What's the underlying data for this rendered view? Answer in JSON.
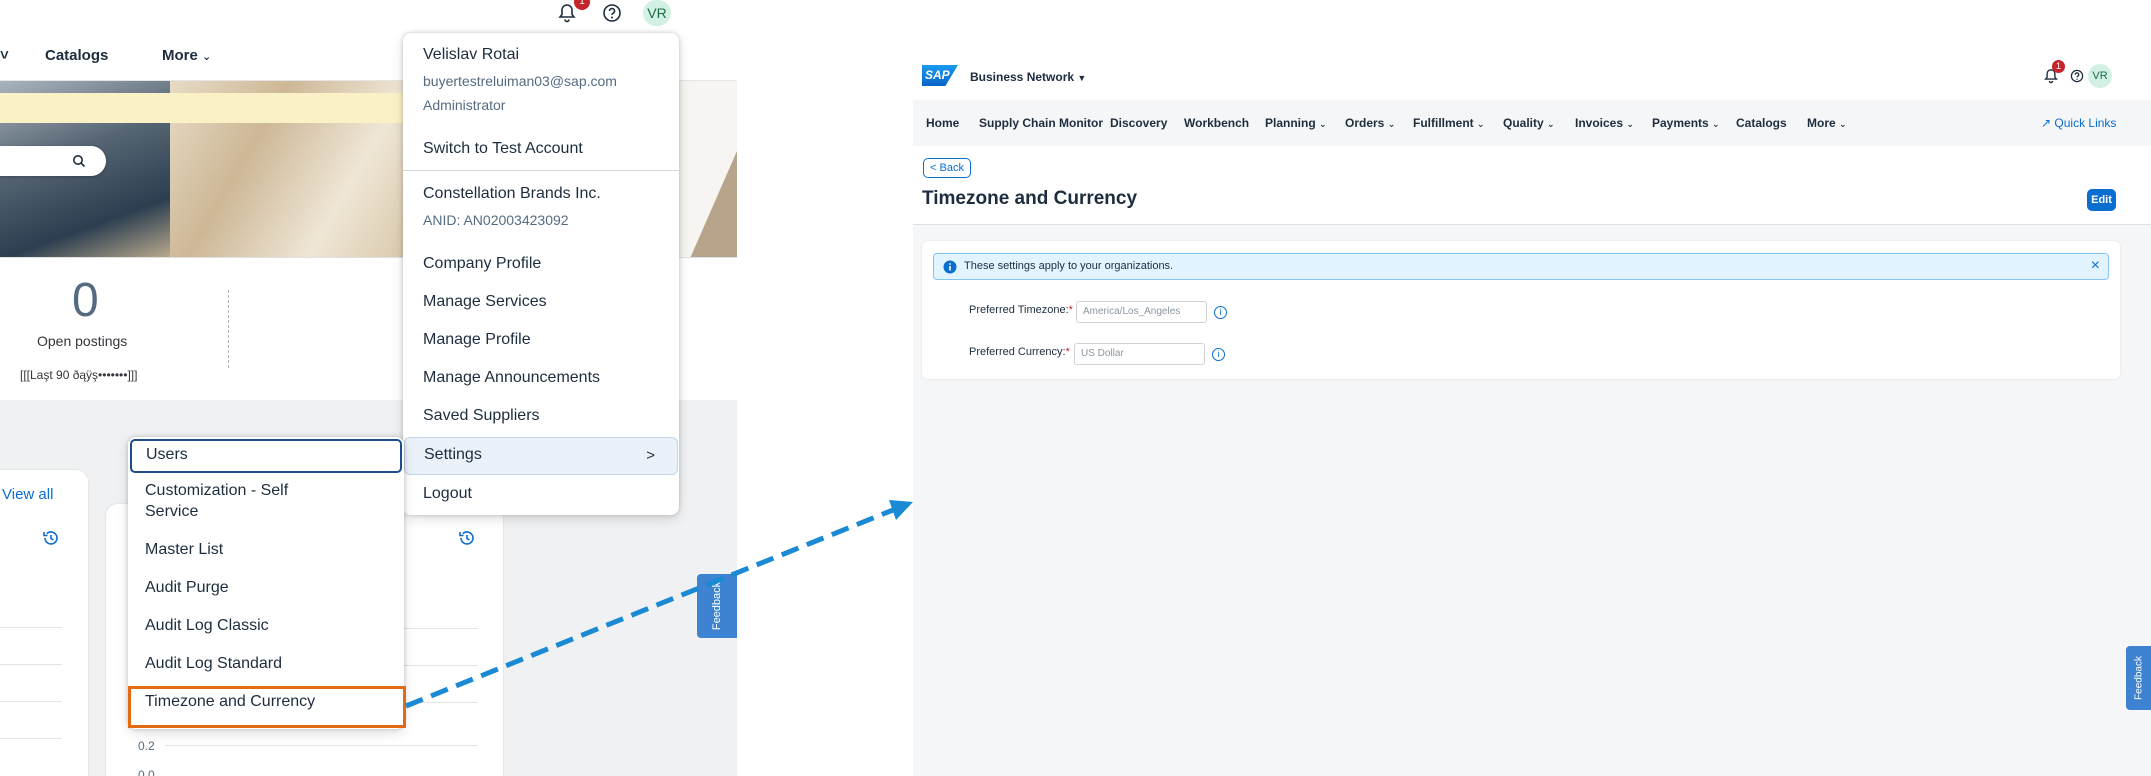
{
  "left": {
    "nav": {
      "catalogs": "Catalogs",
      "more": "More"
    },
    "top": {
      "badge": "1",
      "avatar": "VR"
    },
    "stats": {
      "value": "0",
      "label": "Open postings",
      "period": "[[[Laşt 90 ðąÿş•••••••]]]"
    },
    "view_all": "View all",
    "axis": [
      "0.2",
      "0.0"
    ],
    "feedback": "Feedback",
    "user_menu": {
      "name": "Velislav Rotai",
      "email": "buyertestreluiman03@sap.com",
      "role": "Administrator",
      "switch": "Switch to Test Account",
      "company": "Constellation Brands Inc.",
      "anid": "ANID: AN02003423092",
      "items": [
        "Company Profile",
        "Manage Services",
        "Manage Profile",
        "Manage Announcements",
        "Saved Suppliers"
      ],
      "settings": "Settings",
      "logout": "Logout"
    },
    "settings_menu": {
      "users": "Users",
      "customization_1": "Customization - Self",
      "customization_2": "Service",
      "master_list": "Master List",
      "audit_purge": "Audit Purge",
      "audit_log_classic": "Audit Log Classic",
      "audit_log_standard": "Audit Log Standard",
      "timezone": "Timezone and Currency"
    },
    "colors": {
      "highlight": "#e26a13",
      "arrow": "#1a8ad4"
    }
  },
  "right": {
    "logo": "SAP",
    "app_title": "Business Network",
    "badge": "1",
    "avatar": "VR",
    "nav": [
      "Home",
      "Supply Chain Monitor",
      "Discovery",
      "Workbench",
      "Planning",
      "Orders",
      "Fulfillment",
      "Quality",
      "Invoices",
      "Payments",
      "Catalogs",
      "More"
    ],
    "quick_links": "Quick Links",
    "back": "Back",
    "title": "Timezone and Currency",
    "edit": "Edit",
    "info": "These settings apply to your organizations.",
    "timezone_label": "Preferred Timezone:",
    "timezone_value": "America/Los_Angeles",
    "currency_label": "Preferred Currency:",
    "currency_value": "US Dollar",
    "feedback": "Feedback"
  }
}
